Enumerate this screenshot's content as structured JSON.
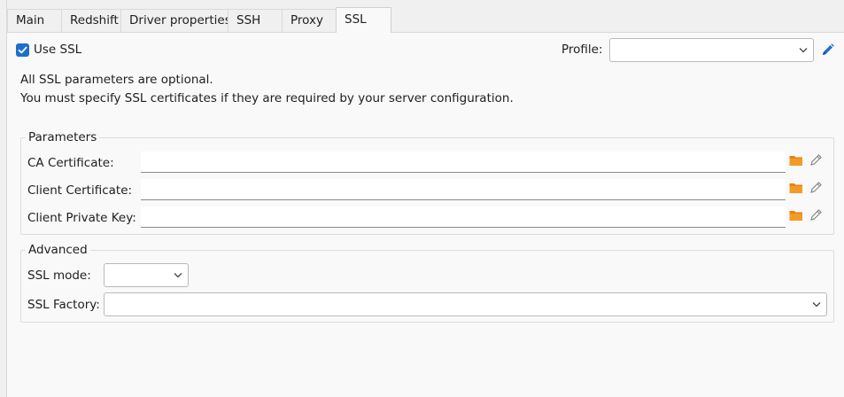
{
  "tabs": [
    {
      "label": "Main"
    },
    {
      "label": "Redshift"
    },
    {
      "label": "Driver properties"
    },
    {
      "label": "SSH"
    },
    {
      "label": "Proxy"
    },
    {
      "label": "SSL"
    }
  ],
  "ssl": {
    "use_ssl_label": "Use SSL",
    "use_ssl_checked": true,
    "profile_label": "Profile:",
    "profile_value": "",
    "info_line1": "All SSL parameters are optional.",
    "info_line2": "You must specify SSL certificates if they are required by your server configuration."
  },
  "parameters": {
    "legend": "Parameters",
    "ca_label": "CA Certificate:",
    "ca_value": "",
    "client_cert_label": "Client Certificate:",
    "client_cert_value": "",
    "client_key_label": "Client Private Key:",
    "client_key_value": ""
  },
  "advanced": {
    "legend": "Advanced",
    "ssl_mode_label": "SSL mode:",
    "ssl_mode_value": "",
    "ssl_factory_label": "SSL Factory:",
    "ssl_factory_value": ""
  },
  "colors": {
    "accent": "#1e6fc9",
    "folder": "#e8820c",
    "edit_icon": "#8a8a8a"
  }
}
